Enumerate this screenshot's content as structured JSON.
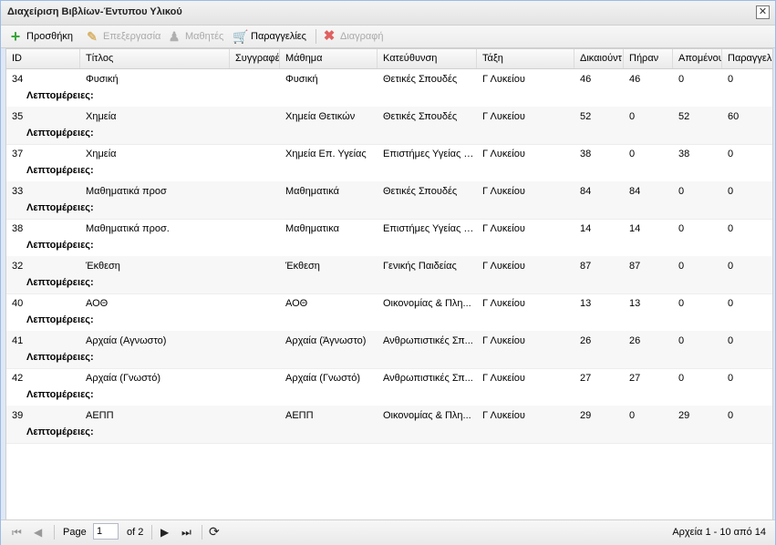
{
  "window": {
    "title": "Διαχείριση Βιβλίων-Έντυπου Υλικού",
    "close_label": "✕"
  },
  "toolbar": {
    "add": "Προσθήκη",
    "edit": "Επεξεργασία",
    "students": "Μαθητές",
    "orders": "Παραγγελίες",
    "delete": "Διαγραφή"
  },
  "columns": [
    "ID",
    "Τίτλος",
    "Συγγραφέας",
    "Μάθημα",
    "Κατεύθυνση",
    "Τάξη",
    "Δικαιούντ",
    "Πήραν",
    "Απομένου",
    "Παραγγελί"
  ],
  "details_label": "Λεπτομέρειες:",
  "rows": [
    {
      "id": "34",
      "title": "Φυσική",
      "author": "",
      "subject": "Φυσική",
      "direction": "Θετικές Σπουδές",
      "grade": "Γ Λυκείου",
      "entitled": "46",
      "took": "46",
      "remaining": "0",
      "ordered": "0"
    },
    {
      "id": "35",
      "title": "Χημεία",
      "author": "",
      "subject": "Χημεία Θετικών",
      "direction": "Θετικές Σπουδές",
      "grade": "Γ Λυκείου",
      "entitled": "52",
      "took": "0",
      "remaining": "52",
      "ordered": "60"
    },
    {
      "id": "37",
      "title": "Χημεία",
      "author": "",
      "subject": "Χημεία Επ. Υγείας",
      "direction": "Επιστήμες Υγείας κ...",
      "grade": "Γ Λυκείου",
      "entitled": "38",
      "took": "0",
      "remaining": "38",
      "ordered": "0"
    },
    {
      "id": "33",
      "title": "Μαθηματικά προσ",
      "author": "",
      "subject": "Μαθηματικά",
      "direction": "Θετικές Σπουδές",
      "grade": "Γ Λυκείου",
      "entitled": "84",
      "took": "84",
      "remaining": "0",
      "ordered": "0"
    },
    {
      "id": "38",
      "title": "Μαθηματικά προσ.",
      "author": "",
      "subject": "Μαθηματικα",
      "direction": "Επιστήμες Υγείας κ...",
      "grade": "Γ Λυκείου",
      "entitled": "14",
      "took": "14",
      "remaining": "0",
      "ordered": "0"
    },
    {
      "id": "32",
      "title": "Έκθεση",
      "author": "",
      "subject": "Έκθεση",
      "direction": "Γενικής Παιδείας",
      "grade": "Γ Λυκείου",
      "entitled": "87",
      "took": "87",
      "remaining": "0",
      "ordered": "0"
    },
    {
      "id": "40",
      "title": "ΑΟΘ",
      "author": "",
      "subject": "ΑΟΘ",
      "direction": "Οικονομίας & Πλη...",
      "grade": "Γ Λυκείου",
      "entitled": "13",
      "took": "13",
      "remaining": "0",
      "ordered": "0"
    },
    {
      "id": "41",
      "title": "Αρχαία (Αγνωστο)",
      "author": "",
      "subject": "Αρχαία (Άγνωστο)",
      "direction": "Ανθρωπιστικές Σπ...",
      "grade": "Γ Λυκείου",
      "entitled": "26",
      "took": "26",
      "remaining": "0",
      "ordered": "0"
    },
    {
      "id": "42",
      "title": "Αρχαία (Γνωστό)",
      "author": "",
      "subject": "Αρχαία (Γνωστό)",
      "direction": "Ανθρωπιστικές Σπ...",
      "grade": "Γ Λυκείου",
      "entitled": "27",
      "took": "27",
      "remaining": "0",
      "ordered": "0"
    },
    {
      "id": "39",
      "title": "ΑΕΠΠ",
      "author": "",
      "subject": "ΑΕΠΠ",
      "direction": "Οικονομίας & Πλη...",
      "grade": "Γ Λυκείου",
      "entitled": "29",
      "took": "0",
      "remaining": "29",
      "ordered": "0"
    }
  ],
  "pager": {
    "page_label": "Page",
    "page_value": "1",
    "of_label": "of 2",
    "status": "Αρχεία 1 - 10 από 14"
  },
  "colors": {
    "add_icon": "#3aa53a",
    "delete_icon": "#e06060",
    "border": "#99bbe8"
  }
}
